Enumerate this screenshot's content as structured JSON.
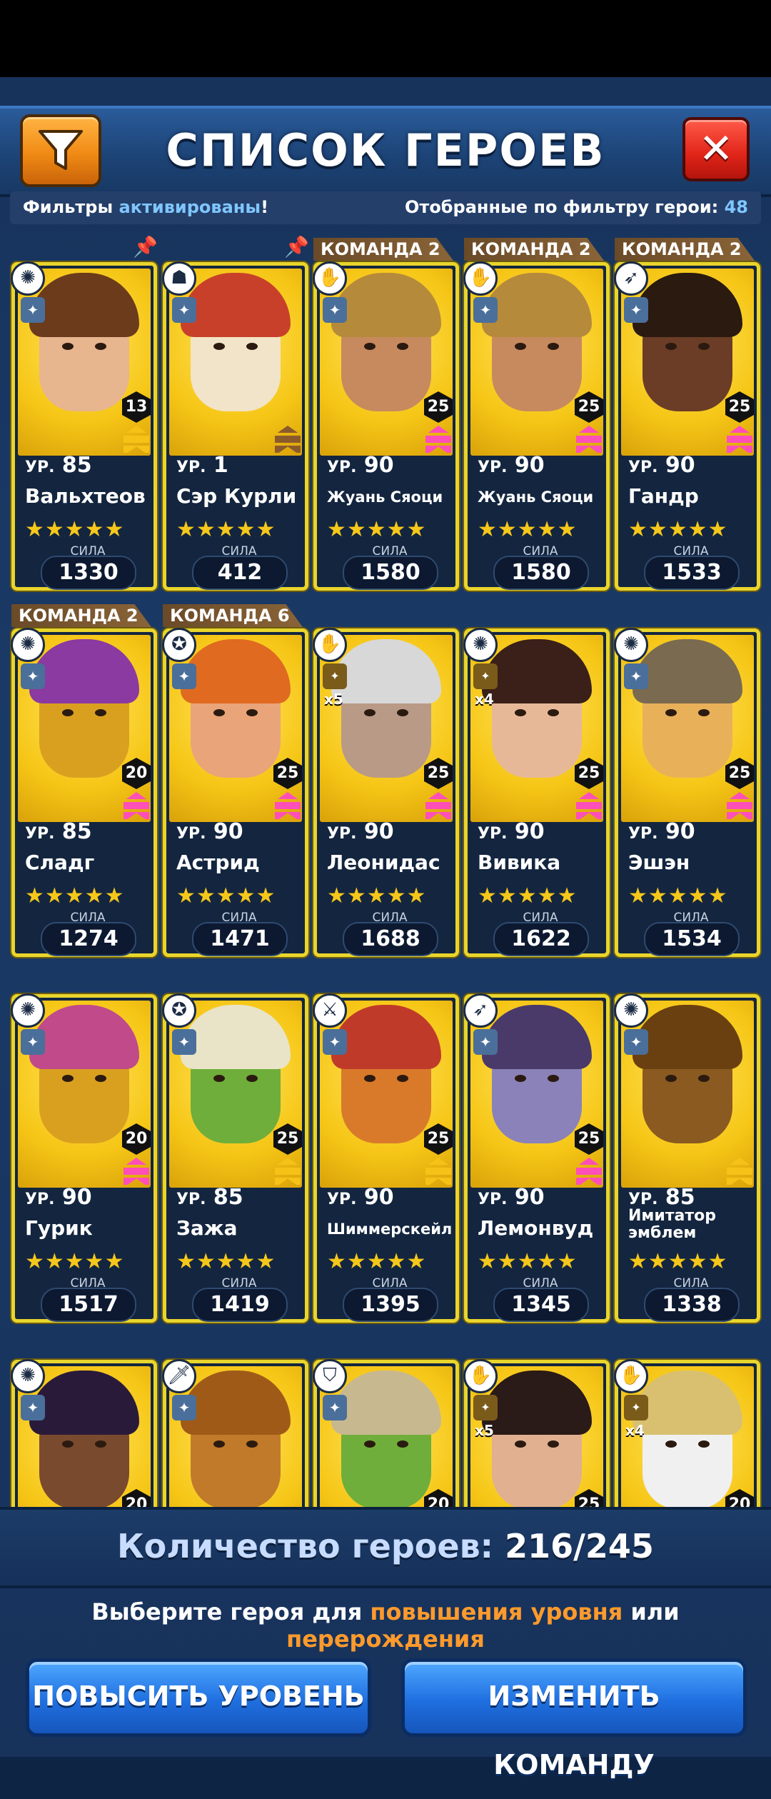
{
  "header": {
    "title": "СПИСОК ГЕРОЕВ",
    "filter_icon": "filter-funnel-icon",
    "close_icon": "close-x-icon"
  },
  "filter_bar": {
    "status_prefix": "Фильтры",
    "status_highlight": "активированы",
    "status_suffix": "!",
    "count_label": "Отобранные по фильтру герои:",
    "count_value": "48"
  },
  "labels": {
    "level_prefix": "УР.",
    "power": "СИЛА",
    "stars": "★★★★★"
  },
  "heroes": [
    {
      "name": "Вальхтеов",
      "level": "85",
      "rank": "13",
      "power": "1330",
      "tag": "",
      "class_icon": "sun-icon",
      "face": "#e7b58e",
      "hair": "#6b3b1c",
      "chev": "#f6c218"
    },
    {
      "name": "Сэр Курли",
      "level": "1",
      "rank": "",
      "power": "412",
      "tag": "",
      "class_icon": "mask-icon",
      "face": "#f2e4c8",
      "hair": "#c8402a",
      "chev": "#8b5a2b"
    },
    {
      "name": "Жуань Сяоци",
      "level": "90",
      "rank": "25",
      "power": "1580",
      "tag": "КОМАНДА 2",
      "class_icon": "hand-icon",
      "face": "#c78a5e",
      "hair": "#b58a3a",
      "chev": "#ff4fb8"
    },
    {
      "name": "Жуань Сяоци",
      "level": "90",
      "rank": "25",
      "power": "1580",
      "tag": "КОМАНДА 2",
      "class_icon": "hand-icon",
      "face": "#c78a5e",
      "hair": "#b58a3a",
      "chev": "#ff4fb8"
    },
    {
      "name": "Гандр",
      "level": "90",
      "rank": "25",
      "power": "1533",
      "tag": "КОМАНДА 2",
      "class_icon": "bow-icon",
      "face": "#6b3d26",
      "hair": "#2a1a10",
      "chev": "#ff4fb8"
    },
    {
      "name": "Сладг",
      "level": "85",
      "rank": "20",
      "power": "1274",
      "tag": "КОМАНДА 2",
      "class_icon": "sun-icon",
      "face": "#d9a020",
      "hair": "#8a3aa0",
      "chev": "#ff4fb8"
    },
    {
      "name": "Астрид",
      "level": "90",
      "rank": "25",
      "power": "1471",
      "tag": "КОМАНДА 6",
      "class_icon": "pentagram-icon",
      "face": "#e9a47a",
      "hair": "#e06a20",
      "chev": "#ff4fb8"
    },
    {
      "name": "Леонидас",
      "level": "90",
      "rank": "25",
      "power": "1688",
      "tag": "",
      "class_icon": "hand-icon",
      "face": "#b99a86",
      "hair": "#d8d8d8",
      "chev": "#ff4fb8",
      "mult": "x5"
    },
    {
      "name": "Вивика",
      "level": "90",
      "rank": "25",
      "power": "1622",
      "tag": "",
      "class_icon": "sun-icon",
      "face": "#e7b898",
      "hair": "#3a2018",
      "chev": "#ff4fb8",
      "mult": "x4"
    },
    {
      "name": "Эшэн",
      "level": "90",
      "rank": "25",
      "power": "1534",
      "tag": "",
      "class_icon": "sun-icon",
      "face": "#e9b05a",
      "hair": "#7a6a50",
      "chev": "#ff4fb8"
    },
    {
      "name": "Гурик",
      "level": "90",
      "rank": "20",
      "power": "1517",
      "tag": "",
      "class_icon": "sun-icon",
      "face": "#d9a020",
      "hair": "#c04a8a",
      "chev": "#ff4fb8"
    },
    {
      "name": "Зажа",
      "level": "85",
      "rank": "25",
      "power": "1419",
      "tag": "",
      "class_icon": "pentagram-icon",
      "face": "#6fae3a",
      "hair": "#e9e4c8",
      "chev": "#f6c218"
    },
    {
      "name": "Шиммерскейл",
      "level": "90",
      "rank": "25",
      "power": "1395",
      "tag": "",
      "class_icon": "swords-icon",
      "face": "#d97a2a",
      "hair": "#c03a2a",
      "chev": "#f6c218"
    },
    {
      "name": "Лемонвуд",
      "level": "90",
      "rank": "25",
      "power": "1345",
      "tag": "",
      "class_icon": "bow-icon",
      "face": "#8a82b8",
      "hair": "#4a3a6a",
      "chev": "#ff4fb8"
    },
    {
      "name": "Имитатор эмблем",
      "level": "85",
      "rank": "",
      "power": "1338",
      "tag": "",
      "class_icon": "sun-icon",
      "face": "#8a5a20",
      "hair": "#6a4010",
      "chev": "#f6c218"
    },
    {
      "name": "",
      "level": "",
      "rank": "20",
      "power": "",
      "tag": "",
      "class_icon": "sun-icon",
      "face": "#7a4a2e",
      "hair": "#2a1a3a",
      "chev": "#f6c218"
    },
    {
      "name": "",
      "level": "",
      "rank": "",
      "power": "",
      "tag": "",
      "class_icon": "sword-icon",
      "face": "#c07a2a",
      "hair": "#a05a18",
      "chev": "#f6c218"
    },
    {
      "name": "",
      "level": "",
      "rank": "20",
      "power": "",
      "tag": "",
      "class_icon": "shield-icon",
      "face": "#6fae3a",
      "hair": "#c8b890",
      "chev": "#f6c218"
    },
    {
      "name": "",
      "level": "",
      "rank": "25",
      "power": "",
      "tag": "",
      "class_icon": "hand-icon",
      "face": "#e0b090",
      "hair": "#2a1a18",
      "chev": "#ff4fb8",
      "mult": "x5"
    },
    {
      "name": "",
      "level": "",
      "rank": "20",
      "power": "",
      "tag": "",
      "class_icon": "hand-icon",
      "face": "#f0f0f0",
      "hair": "#d8c070",
      "chev": "#f6c218",
      "mult": "x4"
    }
  ],
  "footer": {
    "count_label": "Количество героев:",
    "count_value": "216/245",
    "hint_prefix": "Выберите героя для",
    "hint_level": "повышения уровня",
    "hint_mid": "или",
    "hint_rebirth": "перерождения",
    "level_up_button": "ПОВЫСИТЬ УРОВЕНЬ",
    "change_team_button": "ИЗМЕНИТЬ КОМАНДУ"
  }
}
